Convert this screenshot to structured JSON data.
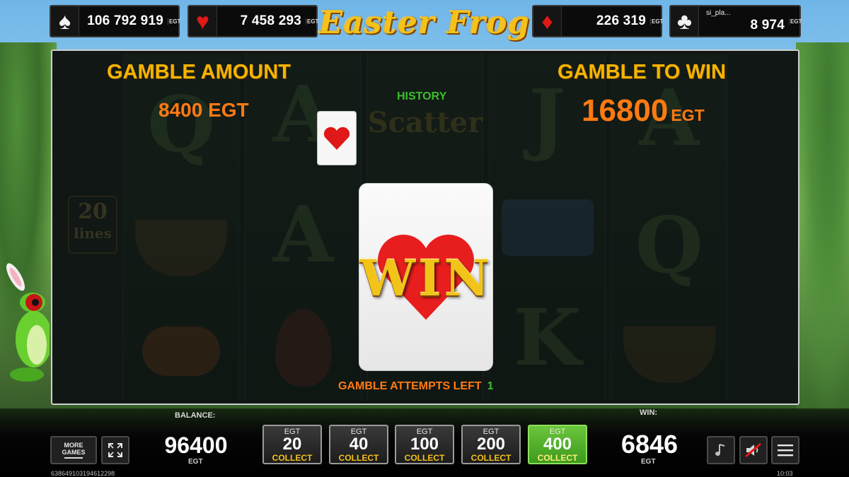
{
  "jackpots": [
    {
      "suit": "spade",
      "glyph": "♠",
      "value": "106 792 919",
      "badge": "EGT"
    },
    {
      "suit": "heart",
      "glyph": "♥",
      "value": "7 458 293",
      "badge": "EGT"
    },
    {
      "suit": "diamond",
      "glyph": "♦",
      "value": "226 319",
      "badge": "EGT"
    },
    {
      "suit": "club",
      "glyph": "♣",
      "value": "8 974",
      "badge": "EGT",
      "user": "si_pla..."
    }
  ],
  "logo": {
    "text": "Easter Frog"
  },
  "background_reels": {
    "lines_number": "20",
    "lines_label": "lines"
  },
  "gamble": {
    "amount_label": "GAMBLE AMOUNT",
    "amount_value": "8400 EGT",
    "to_win_label": "GAMBLE TO WIN",
    "to_win_value": "16800",
    "to_win_unit": "EGT",
    "history_label": "HISTORY",
    "history_cards": [
      "heart"
    ],
    "current_card": "heart",
    "result_text": "WIN",
    "attempts_label": "GAMBLE ATTEMPTS LEFT",
    "attempts_value": "1"
  },
  "bottom": {
    "more_games_label": "MORE\nGAMES",
    "balance_label": "BALANCE:",
    "balance_value": "96400",
    "balance_unit": "EGT",
    "win_label": "WIN:",
    "win_value": "6846",
    "win_unit": "EGT",
    "stakes": [
      {
        "currency": "EGT",
        "value": "20",
        "action": "COLLECT",
        "active": false
      },
      {
        "currency": "EGT",
        "value": "40",
        "action": "COLLECT",
        "active": false
      },
      {
        "currency": "EGT",
        "value": "100",
        "action": "COLLECT",
        "active": false
      },
      {
        "currency": "EGT",
        "value": "200",
        "action": "COLLECT",
        "active": false
      },
      {
        "currency": "EGT",
        "value": "400",
        "action": "COLLECT",
        "active": true
      }
    ],
    "session_id": "638649103194612298",
    "clock": "10:03"
  },
  "colors": {
    "gold": "#f6b400",
    "orange": "#ff7a12",
    "green": "#3bbf2a",
    "heart_red": "#e01818",
    "active_stake": "#4fae2a"
  }
}
